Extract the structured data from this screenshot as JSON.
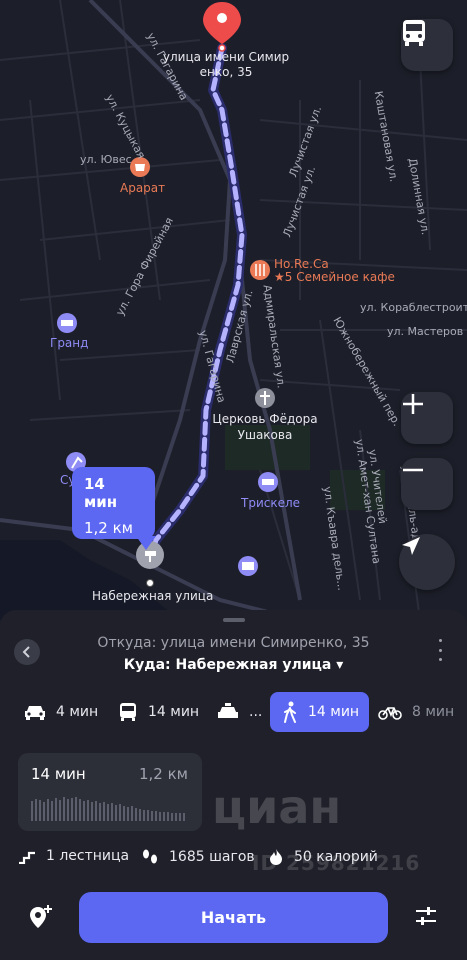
{
  "map": {
    "streets": {
      "gagarina_top": "ул. Гагарина",
      "gagarina_mid": "ул. Гагарина",
      "kuts_kaya": "ул. Куцыкая",
      "yuves": "ул. Ювес",
      "gora_firelnaya": "ул. Гора Фирейная",
      "admiralskaya": "Адмиральская ул.",
      "lavrskaya": "Лаврская ул.",
      "luchistaya_1": "Лучистая ул.",
      "luchistaya_2": "Лучистая ул.",
      "kashtanovaya": "Каштановая ул.",
      "dolinnaya": "Долинная ул.",
      "korablestroiteley": "ул. Кораблестроител",
      "masterov": "ул. Мастеров",
      "yuzhnoberezhny": "Южнобережный пер.",
      "amet_khan": "ул. Амет-хан Султана",
      "uchiteley": "ул. Учителей",
      "eshil_ada": "ул. Ешиль-ада",
      "kyavra_dolina": "ул. Къавра дель..."
    },
    "pois": {
      "dest_address": "улица имени Симир енко, 35",
      "ararat": "Арарат",
      "horeca": "Ho.Re.Ca",
      "semeynoe": "★5 Семейное кафе",
      "grand": "Гранд",
      "church": "Церковь Фёдора Ушакова",
      "triskele": "Трискеле",
      "su": "Су",
      "start_label": "Набережная улица"
    },
    "route_bubble": {
      "time": "14 мин",
      "distance": "1,2 км"
    },
    "buttons": {
      "transit": "bus-icon",
      "zoom_in": "plus-icon",
      "zoom_out": "minus-icon",
      "locate": "navigation-arrow-icon"
    }
  },
  "sheet": {
    "from": "Откуда: улица имени Симиренко, 35",
    "to": "Куда: Набережная улица ▾",
    "modes": [
      {
        "icon": "car-icon",
        "label": "4 мин"
      },
      {
        "icon": "bus-icon",
        "label": "14 мин"
      },
      {
        "icon": "taxi-icon",
        "label": "..."
      },
      {
        "icon": "walk-icon",
        "label": "14 мин",
        "active": true
      },
      {
        "icon": "bike-icon",
        "label": "8 мин"
      }
    ],
    "card": {
      "time": "14 мин",
      "distance": "1,2 км"
    },
    "stats": {
      "stairs": "1 лестница",
      "steps": "1685 шагов",
      "calories": "50 калорий"
    },
    "start_button": "Начать",
    "watermark": {
      "text": "циан",
      "id": "ID 259821216"
    }
  },
  "colors": {
    "accent": "#5c67f2",
    "background": "#1f2029",
    "map": "#1c1e29",
    "poi_orange": "#e97a55"
  }
}
